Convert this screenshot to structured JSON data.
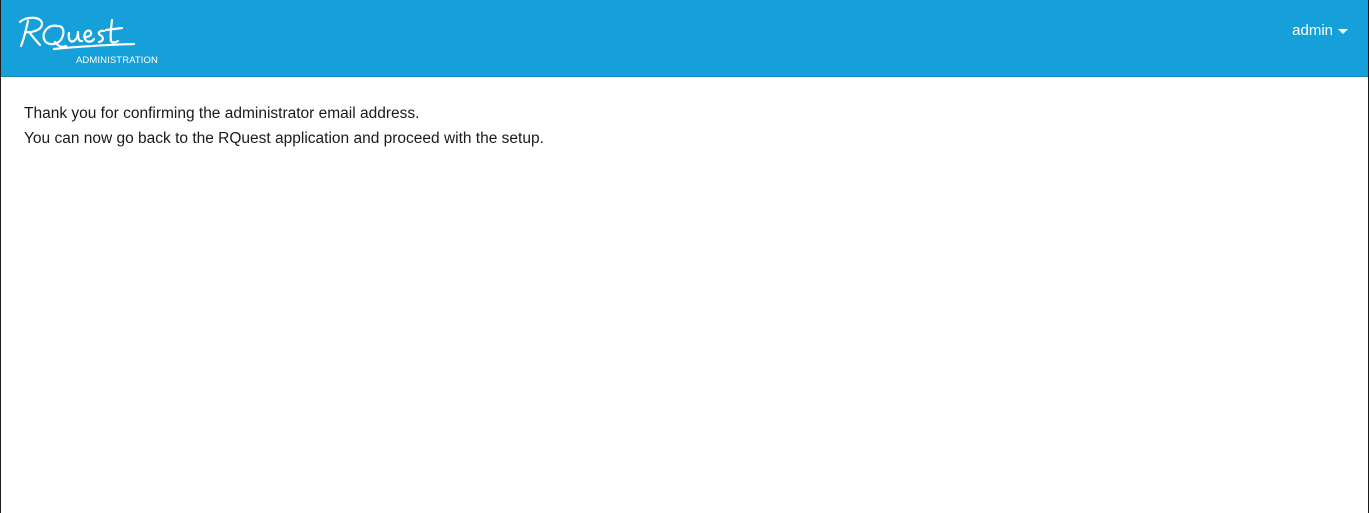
{
  "header": {
    "logo_subtitle": "ADMINISTRATION",
    "user_menu_label": "admin",
    "background_color": "#15a0da"
  },
  "main": {
    "line1": "Thank you for confirming the administrator email address.",
    "line2": "You can now go back to the RQuest application and proceed with the setup."
  },
  "icons": {
    "user_menu_caret": "caret-down-icon"
  }
}
